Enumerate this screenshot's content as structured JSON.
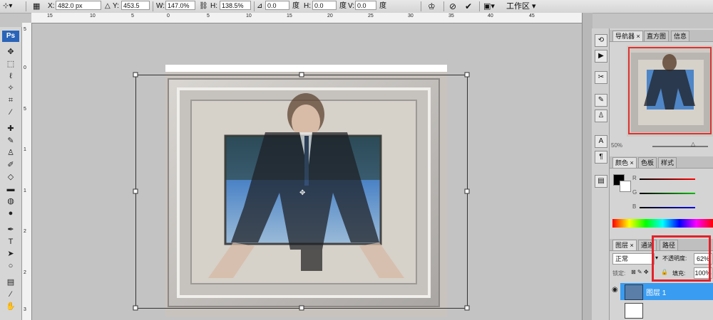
{
  "options_bar": {
    "x_label": "X:",
    "x_value": "482.0 px",
    "y_label": "Y:",
    "y_value": "453.5 px",
    "w_label": "W:",
    "w_value": "147.0%",
    "h_label": "H:",
    "h_value": "138.5%",
    "rotate_value": "0.0",
    "rotate_unit": "度",
    "hskew_label": "H:",
    "hskew_value": "0.0",
    "hskew_unit": "度",
    "vskew_label": "V:",
    "vskew_value": "0.0",
    "vskew_unit": "度",
    "workspace_label": "工作区"
  },
  "ruler_top": [
    "15",
    "10",
    "5",
    "0",
    "5",
    "10",
    "15",
    "20",
    "25",
    "30",
    "35",
    "40",
    "45"
  ],
  "ruler_left": [
    "5",
    "0",
    "5",
    "1",
    "1",
    "2",
    "2",
    "3"
  ],
  "tools": {
    "logo": "Ps"
  },
  "panels": {
    "navigator_tabs": [
      "导航器",
      "直方图",
      "信息"
    ],
    "zoom_value": "50%",
    "color_tabs": [
      "颜色",
      "色板",
      "样式"
    ],
    "color_channels": [
      "R",
      "G",
      "B"
    ],
    "layer_tabs": [
      "图层",
      "通道",
      "路径"
    ],
    "blend_mode": "正常",
    "opacity_label": "不透明度:",
    "opacity_value": "62%",
    "lock_label": "锁定:",
    "fill_label": "填充:",
    "fill_value": "100%",
    "layer1_name": "图层 1"
  },
  "colors": {
    "selection_highlight": "#e3222a",
    "active_layer": "#3a9cf0",
    "ps_logo": "#2a64b8"
  }
}
